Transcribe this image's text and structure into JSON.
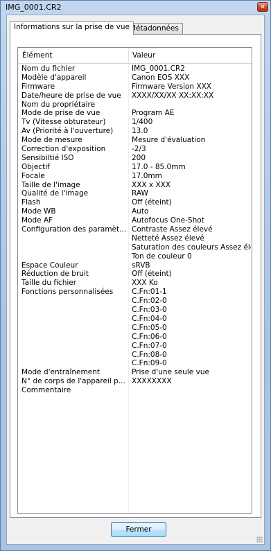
{
  "window": {
    "title": "IMG_0001.CR2",
    "close_glyph": "×"
  },
  "tabs": [
    {
      "label": "Informations sur la prise de vue",
      "active": true
    },
    {
      "label": "Métadonnées",
      "active": false
    }
  ],
  "table": {
    "columns": [
      "Élément",
      "Valeur"
    ],
    "rows": [
      [
        "Nom du fichier",
        "IMG_0001.CR2"
      ],
      [
        "Modèle d'appareil",
        "Canon EOS XXX"
      ],
      [
        "Firmware",
        "Firmware Version XXX"
      ],
      [
        "Date/heure de prise de vue",
        "XXXX/XX/XX XX:XX:XX"
      ],
      [
        "Nom du propriétaire",
        ""
      ],
      [
        "Mode de prise de vue",
        "Program AE"
      ],
      [
        "Tv (Vitesse obturateur)",
        "1/400"
      ],
      [
        "Av (Priorité à l'ouverture)",
        "13.0"
      ],
      [
        "Mode de mesure",
        "Mesure d'évaluation"
      ],
      [
        "Correction d'exposition",
        "-2/3"
      ],
      [
        "Sensibiltié ISO",
        "200"
      ],
      [
        "Objectif",
        "17.0 - 85.0mm"
      ],
      [
        "Focale",
        "17.0mm"
      ],
      [
        "Taille de l'image",
        "XXX x XXX"
      ],
      [
        "Qualité de l'image",
        "RAW"
      ],
      [
        "Flash",
        "Off (éteint)"
      ],
      [
        "Mode WB",
        "Auto"
      ],
      [
        "Mode AF",
        "Autofocus One-Shot"
      ],
      [
        "Configuration des paramèt...",
        "Contraste  Assez élevé"
      ],
      [
        "",
        "Netteté  Assez élevé"
      ],
      [
        "",
        "Saturation des couleurs  Assez élevé"
      ],
      [
        "",
        "Ton de couleur  0"
      ],
      [
        "Espace Couleur",
        "sRVB"
      ],
      [
        "Réduction de bruit",
        "Off (éteint)"
      ],
      [
        "Taille du fichier",
        "XXX Ko"
      ],
      [
        "Fonctions personnalisées",
        "C.Fn:01-1"
      ],
      [
        "",
        "C.Fn:02-0"
      ],
      [
        "",
        "C.Fn:03-0"
      ],
      [
        "",
        "C.Fn:04-0"
      ],
      [
        "",
        "C.Fn:05-0"
      ],
      [
        "",
        "C.Fn:06-0"
      ],
      [
        "",
        "C.Fn:07-0"
      ],
      [
        "",
        "C.Fn:08-0"
      ],
      [
        "",
        "C.Fn:09-0"
      ],
      [
        "Mode d'entraînement",
        "Prise d'une seule vue"
      ],
      [
        "N° de corps de l'appareil p...",
        "XXXXXXXX"
      ],
      [
        "Commentaire",
        ""
      ]
    ]
  },
  "buttons": {
    "close_label": "Fermer"
  }
}
